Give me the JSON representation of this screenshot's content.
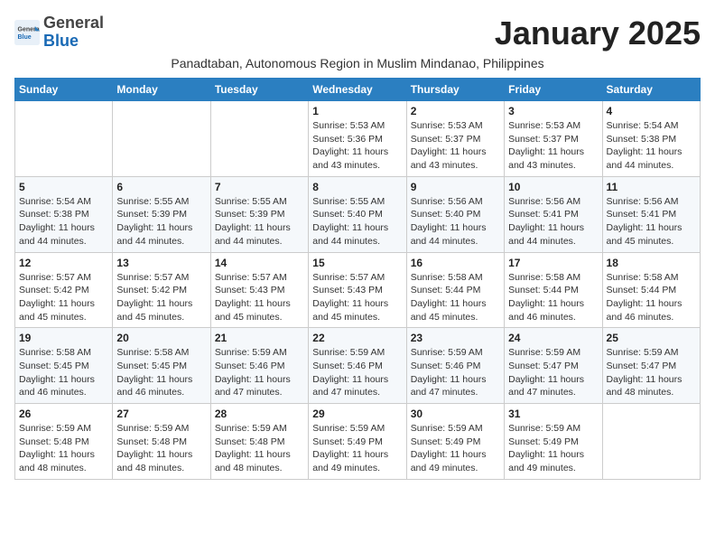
{
  "header": {
    "logo_general": "General",
    "logo_blue": "Blue",
    "month_title": "January 2025",
    "subtitle": "Panadtaban, Autonomous Region in Muslim Mindanao, Philippines"
  },
  "weekdays": [
    "Sunday",
    "Monday",
    "Tuesday",
    "Wednesday",
    "Thursday",
    "Friday",
    "Saturday"
  ],
  "weeks": [
    [
      {
        "day": "",
        "info": ""
      },
      {
        "day": "",
        "info": ""
      },
      {
        "day": "",
        "info": ""
      },
      {
        "day": "1",
        "info": "Sunrise: 5:53 AM\nSunset: 5:36 PM\nDaylight: 11 hours and 43 minutes."
      },
      {
        "day": "2",
        "info": "Sunrise: 5:53 AM\nSunset: 5:37 PM\nDaylight: 11 hours and 43 minutes."
      },
      {
        "day": "3",
        "info": "Sunrise: 5:53 AM\nSunset: 5:37 PM\nDaylight: 11 hours and 43 minutes."
      },
      {
        "day": "4",
        "info": "Sunrise: 5:54 AM\nSunset: 5:38 PM\nDaylight: 11 hours and 44 minutes."
      }
    ],
    [
      {
        "day": "5",
        "info": "Sunrise: 5:54 AM\nSunset: 5:38 PM\nDaylight: 11 hours and 44 minutes."
      },
      {
        "day": "6",
        "info": "Sunrise: 5:55 AM\nSunset: 5:39 PM\nDaylight: 11 hours and 44 minutes."
      },
      {
        "day": "7",
        "info": "Sunrise: 5:55 AM\nSunset: 5:39 PM\nDaylight: 11 hours and 44 minutes."
      },
      {
        "day": "8",
        "info": "Sunrise: 5:55 AM\nSunset: 5:40 PM\nDaylight: 11 hours and 44 minutes."
      },
      {
        "day": "9",
        "info": "Sunrise: 5:56 AM\nSunset: 5:40 PM\nDaylight: 11 hours and 44 minutes."
      },
      {
        "day": "10",
        "info": "Sunrise: 5:56 AM\nSunset: 5:41 PM\nDaylight: 11 hours and 44 minutes."
      },
      {
        "day": "11",
        "info": "Sunrise: 5:56 AM\nSunset: 5:41 PM\nDaylight: 11 hours and 45 minutes."
      }
    ],
    [
      {
        "day": "12",
        "info": "Sunrise: 5:57 AM\nSunset: 5:42 PM\nDaylight: 11 hours and 45 minutes."
      },
      {
        "day": "13",
        "info": "Sunrise: 5:57 AM\nSunset: 5:42 PM\nDaylight: 11 hours and 45 minutes."
      },
      {
        "day": "14",
        "info": "Sunrise: 5:57 AM\nSunset: 5:43 PM\nDaylight: 11 hours and 45 minutes."
      },
      {
        "day": "15",
        "info": "Sunrise: 5:57 AM\nSunset: 5:43 PM\nDaylight: 11 hours and 45 minutes."
      },
      {
        "day": "16",
        "info": "Sunrise: 5:58 AM\nSunset: 5:44 PM\nDaylight: 11 hours and 45 minutes."
      },
      {
        "day": "17",
        "info": "Sunrise: 5:58 AM\nSunset: 5:44 PM\nDaylight: 11 hours and 46 minutes."
      },
      {
        "day": "18",
        "info": "Sunrise: 5:58 AM\nSunset: 5:44 PM\nDaylight: 11 hours and 46 minutes."
      }
    ],
    [
      {
        "day": "19",
        "info": "Sunrise: 5:58 AM\nSunset: 5:45 PM\nDaylight: 11 hours and 46 minutes."
      },
      {
        "day": "20",
        "info": "Sunrise: 5:58 AM\nSunset: 5:45 PM\nDaylight: 11 hours and 46 minutes."
      },
      {
        "day": "21",
        "info": "Sunrise: 5:59 AM\nSunset: 5:46 PM\nDaylight: 11 hours and 47 minutes."
      },
      {
        "day": "22",
        "info": "Sunrise: 5:59 AM\nSunset: 5:46 PM\nDaylight: 11 hours and 47 minutes."
      },
      {
        "day": "23",
        "info": "Sunrise: 5:59 AM\nSunset: 5:46 PM\nDaylight: 11 hours and 47 minutes."
      },
      {
        "day": "24",
        "info": "Sunrise: 5:59 AM\nSunset: 5:47 PM\nDaylight: 11 hours and 47 minutes."
      },
      {
        "day": "25",
        "info": "Sunrise: 5:59 AM\nSunset: 5:47 PM\nDaylight: 11 hours and 48 minutes."
      }
    ],
    [
      {
        "day": "26",
        "info": "Sunrise: 5:59 AM\nSunset: 5:48 PM\nDaylight: 11 hours and 48 minutes."
      },
      {
        "day": "27",
        "info": "Sunrise: 5:59 AM\nSunset: 5:48 PM\nDaylight: 11 hours and 48 minutes."
      },
      {
        "day": "28",
        "info": "Sunrise: 5:59 AM\nSunset: 5:48 PM\nDaylight: 11 hours and 48 minutes."
      },
      {
        "day": "29",
        "info": "Sunrise: 5:59 AM\nSunset: 5:49 PM\nDaylight: 11 hours and 49 minutes."
      },
      {
        "day": "30",
        "info": "Sunrise: 5:59 AM\nSunset: 5:49 PM\nDaylight: 11 hours and 49 minutes."
      },
      {
        "day": "31",
        "info": "Sunrise: 5:59 AM\nSunset: 5:49 PM\nDaylight: 11 hours and 49 minutes."
      },
      {
        "day": "",
        "info": ""
      }
    ]
  ]
}
